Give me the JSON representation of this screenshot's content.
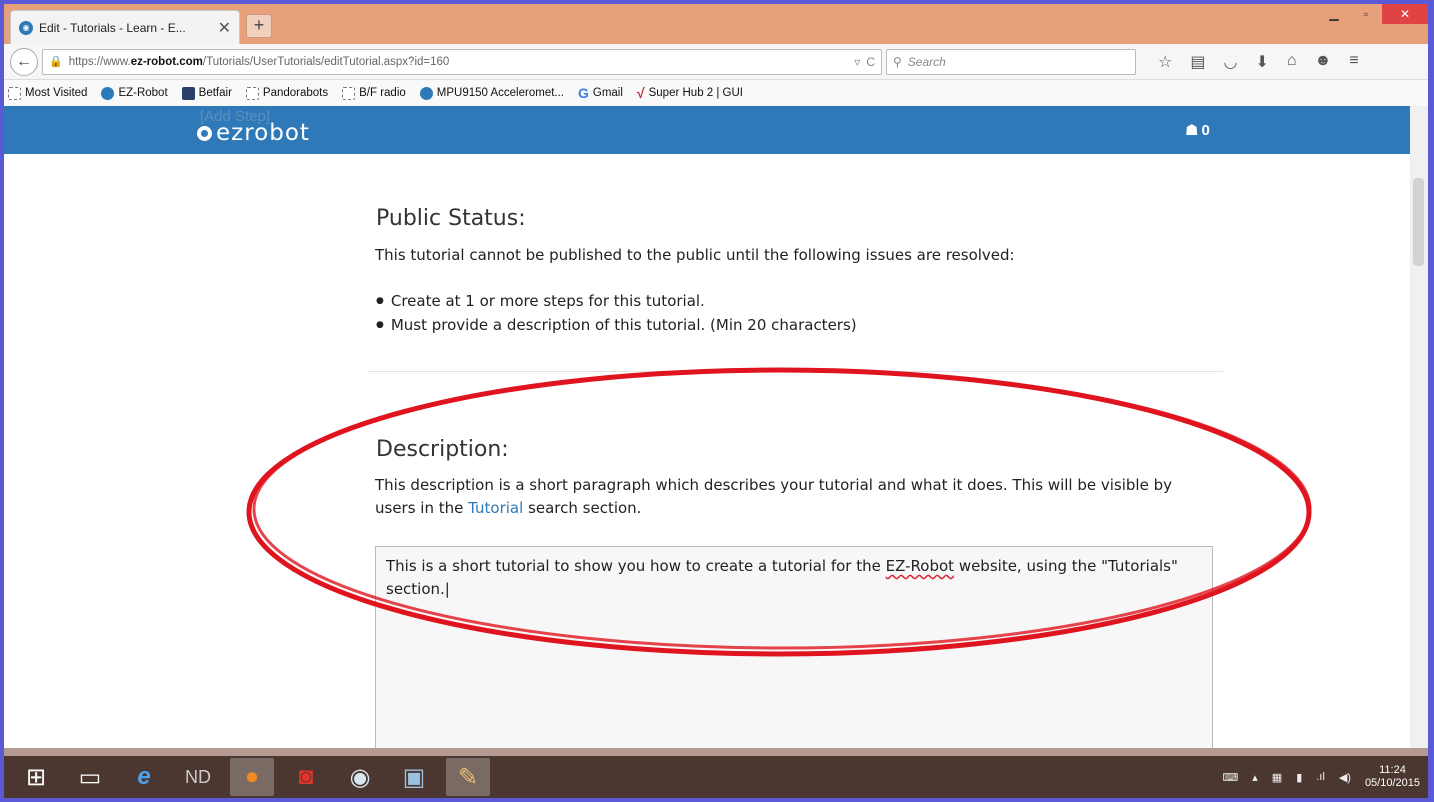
{
  "browser": {
    "tab_title": "Edit - Tutorials - Learn - E...",
    "tab_close": "✕",
    "new_tab": "+",
    "url_prefix": "https://www.",
    "url_domain": "ez-robot.com",
    "url_path": "/Tutorials/UserTutorials/editTutorial.aspx?id=160",
    "search_placeholder": "Search",
    "bookmarks": [
      {
        "label": "Most Visited",
        "icon": "star-folder-icon"
      },
      {
        "label": "EZ-Robot",
        "icon": "ezrobot-favicon"
      },
      {
        "label": "Betfair",
        "icon": "betfair-favicon"
      },
      {
        "label": "Pandorabots",
        "icon": "blank-page-icon"
      },
      {
        "label": "B/F radio",
        "icon": "blank-page-icon"
      },
      {
        "label": "MPU9150 Acceleromet...",
        "icon": "ezrobot-favicon"
      },
      {
        "label": "Gmail",
        "icon": "google-g-icon"
      },
      {
        "label": "Super Hub 2 | GUI",
        "icon": "red-tick-icon"
      }
    ]
  },
  "site": {
    "ghost_text": "[Add Step]",
    "logo_text": "ezrobot",
    "cart_count": "0"
  },
  "public_status": {
    "heading": "Public Status:",
    "intro": "This tutorial cannot be published to the public until the following issues are resolved:",
    "issues": [
      "Create at 1 or more steps for this tutorial.",
      "Must provide a description of this tutorial. (Min 20 characters)"
    ]
  },
  "description": {
    "heading": "Description:",
    "text_before": "This description is a short paragraph which describes your tutorial and what it does. This will be visible by users in the ",
    "link": "Tutorial",
    "text_after": " search section.",
    "value_before": "This is a short tutorial to show you how to create a tutorial for the ",
    "value_misspelled": "EZ-Robot",
    "value_after": " website, using the \"Tutorials\" section."
  },
  "taskbar": {
    "time": "11:24",
    "date": "05/10/2015"
  },
  "colors": {
    "header_blue": "#2f79b8",
    "annotation_red": "#e0141e",
    "taskbar": "#4b3730"
  }
}
